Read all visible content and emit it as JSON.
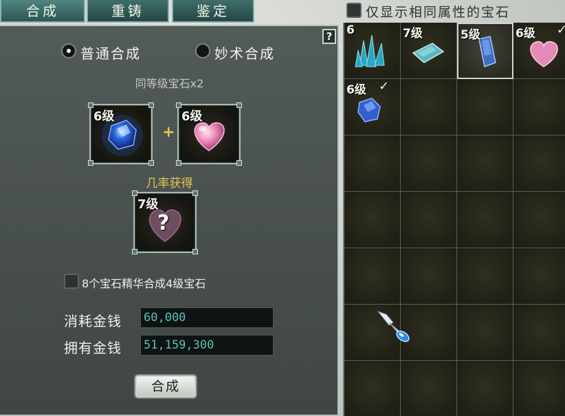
{
  "tabs": [
    {
      "label": "合成"
    },
    {
      "label": "重铸"
    },
    {
      "label": "鉴定"
    }
  ],
  "filter": {
    "label": "仅显示相同属性的宝石",
    "checked": false
  },
  "help_label": "?",
  "modes": {
    "normal_label": "普通合成",
    "special_label": "妙术合成",
    "selected": "normal"
  },
  "hint": "同等级宝石x2",
  "inputs": [
    {
      "level": "6级",
      "gem": "blue-sapphire"
    },
    {
      "level": "6级",
      "gem": "pink-heart"
    }
  ],
  "plus": "+",
  "probability_label": "几率获得",
  "result": {
    "level": "7级",
    "unknown_mark": "?",
    "gem": "pink-heart"
  },
  "essence": {
    "label": "8个宝石精华合成4级宝石",
    "checked": false
  },
  "money": {
    "cost_label": "消耗金钱",
    "cost_value": "60,000",
    "owned_label": "拥有金钱",
    "owned_value": "51,159,300"
  },
  "compose_button": "合成",
  "inventory": [
    {
      "level": "6",
      "gem": "cyan-crystal-cluster",
      "checked": false,
      "selected": false
    },
    {
      "level": "7级",
      "gem": "cyan-prism",
      "checked": false,
      "selected": false
    },
    {
      "level": "5级",
      "gem": "blue-prism",
      "checked": false,
      "selected": true
    },
    {
      "level": "6级",
      "gem": "pink-heart",
      "checked": true,
      "selected": false
    },
    {
      "level": "6级",
      "gem": "blue-sapphire",
      "checked": true,
      "selected": false
    }
  ],
  "check_mark": "✓",
  "colors": {
    "accent_gold": "#e7c64f",
    "money_text": "#58c2b6",
    "tab_bg": "#2e5654"
  }
}
